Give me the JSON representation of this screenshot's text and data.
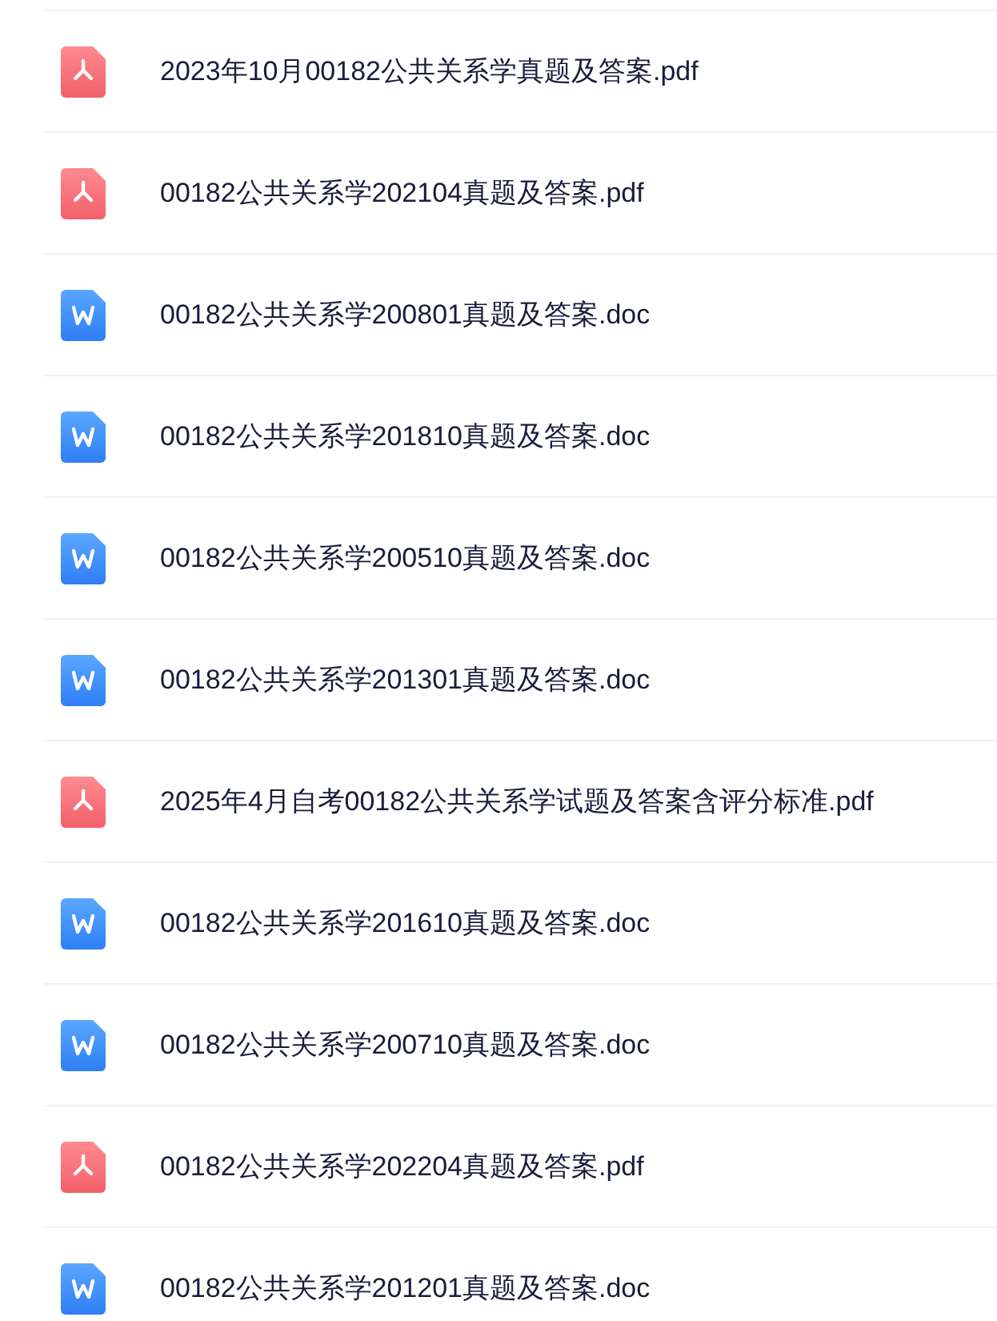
{
  "files": [
    {
      "kind": "pdf",
      "name": "2023年10月00182公共关系学真题及答案.pdf"
    },
    {
      "kind": "pdf",
      "name": "00182公共关系学202104真题及答案.pdf"
    },
    {
      "kind": "doc",
      "name": "00182公共关系学200801真题及答案.doc"
    },
    {
      "kind": "doc",
      "name": "00182公共关系学201810真题及答案.doc"
    },
    {
      "kind": "doc",
      "name": "00182公共关系学200510真题及答案.doc"
    },
    {
      "kind": "doc",
      "name": "00182公共关系学201301真题及答案.doc"
    },
    {
      "kind": "pdf",
      "name": "2025年4月自考00182公共关系学试题及答案含评分标准.pdf"
    },
    {
      "kind": "doc",
      "name": "00182公共关系学201610真题及答案.doc"
    },
    {
      "kind": "doc",
      "name": "00182公共关系学200710真题及答案.doc"
    },
    {
      "kind": "pdf",
      "name": "00182公共关系学202204真题及答案.pdf"
    },
    {
      "kind": "doc",
      "name": "00182公共关系学201201真题及答案.doc"
    }
  ]
}
